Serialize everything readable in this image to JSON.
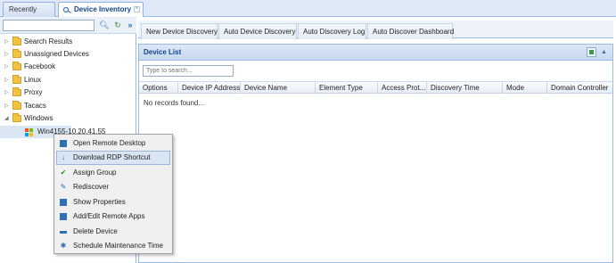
{
  "tabs": {
    "recent_label": "Recently View",
    "active_label": "Device Inventory"
  },
  "left": {
    "search_placeholder": "",
    "tree": [
      {
        "label": "Search Results"
      },
      {
        "label": "Unassigned Devices"
      },
      {
        "label": "Facebook"
      },
      {
        "label": "Linux"
      },
      {
        "label": "Proxy"
      },
      {
        "label": "Tacacs"
      },
      {
        "label": "Windows"
      }
    ],
    "child_label": "Win4155-10.20.41.55"
  },
  "subtabs": [
    {
      "label": "New Device Discovery"
    },
    {
      "label": "Auto Device Discovery"
    },
    {
      "label": "Auto Discovery Log"
    },
    {
      "label": "Auto Discover Dashboard"
    }
  ],
  "panel": {
    "title": "Device List",
    "filter_placeholder": "Type to search...",
    "columns": [
      {
        "label": "Options"
      },
      {
        "label": "Device IP Address"
      },
      {
        "label": "Device Name"
      },
      {
        "label": "Element Type"
      },
      {
        "label": "Access Prot..."
      },
      {
        "label": "Discovery Time"
      },
      {
        "label": "Mode"
      },
      {
        "label": "Domain Controller"
      }
    ],
    "empty_text": "No records found..."
  },
  "context_menu": {
    "items": [
      {
        "label": "Open Remote Desktop"
      },
      {
        "label": "Download RDP Shortcut"
      },
      {
        "label": "Assign Group"
      },
      {
        "label": "Rediscover"
      },
      {
        "label": "Show Properties"
      },
      {
        "label": "Add/Edit Remote Apps"
      },
      {
        "label": "Delete Device"
      },
      {
        "label": "Schedule Maintenance Time"
      }
    ]
  },
  "colors": {
    "accent": "#15428b",
    "border": "#99bbe8",
    "highlight": "#dae5f3"
  }
}
